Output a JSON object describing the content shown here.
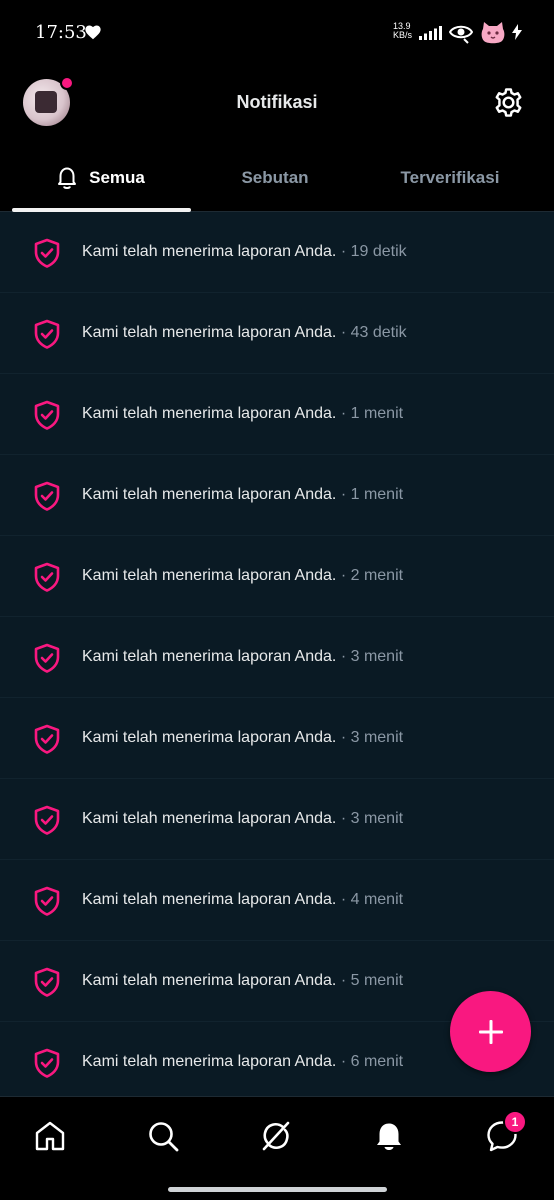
{
  "status_bar": {
    "time": "17:53",
    "speed_value": "13.9",
    "speed_unit": "KB/s"
  },
  "header": {
    "title": "Notifikasi",
    "avatar_badge_color": "#f91880"
  },
  "tabs": [
    {
      "label": "Semua",
      "active": true
    },
    {
      "label": "Sebutan",
      "active": false
    },
    {
      "label": "Terverifikasi",
      "active": false
    }
  ],
  "notifications": [
    {
      "icon": "shield-check-icon",
      "text": "Kami telah menerima laporan Anda.",
      "time": " · 19 detik"
    },
    {
      "icon": "shield-check-icon",
      "text": "Kami telah menerima laporan Anda.",
      "time": " · 43 detik"
    },
    {
      "icon": "shield-check-icon",
      "text": "Kami telah menerima laporan Anda.",
      "time": " · 1 menit"
    },
    {
      "icon": "shield-check-icon",
      "text": "Kami telah menerima laporan Anda.",
      "time": " · 1 menit"
    },
    {
      "icon": "shield-check-icon",
      "text": "Kami telah menerima laporan Anda.",
      "time": " · 2 menit"
    },
    {
      "icon": "shield-check-icon",
      "text": "Kami telah menerima laporan Anda.",
      "time": " · 3 menit"
    },
    {
      "icon": "shield-check-icon",
      "text": "Kami telah menerima laporan Anda.",
      "time": " · 3 menit"
    },
    {
      "icon": "shield-check-icon",
      "text": "Kami telah menerima laporan Anda.",
      "time": " · 3 menit"
    },
    {
      "icon": "shield-check-icon",
      "text": "Kami telah menerima laporan Anda.",
      "time": " · 4 menit"
    },
    {
      "icon": "shield-check-icon",
      "text": "Kami telah menerima laporan Anda.",
      "time": " · 5 menit"
    },
    {
      "icon": "shield-check-icon",
      "text": "Kami telah menerima laporan Anda.",
      "time": " · 6 menit"
    }
  ],
  "bottom_nav": {
    "items": [
      "home-icon",
      "search-icon",
      "grok-icon",
      "bell-icon",
      "messages-icon"
    ],
    "messages_badge": "1"
  },
  "colors": {
    "accent": "#f91880",
    "background": "#000000",
    "list_background": "#0a1a24",
    "secondary_text": "#8b98a5"
  }
}
